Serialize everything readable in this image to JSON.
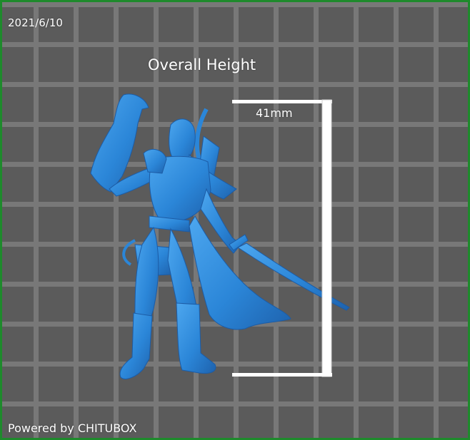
{
  "viewport": {
    "date": "2021/6/10",
    "title": "Overall Height",
    "measurement": "41mm",
    "footer": "Powered by CHITUBOX"
  },
  "model": {
    "name": "miniature-figure",
    "color": "#2b86d8"
  },
  "colors": {
    "frame_border": "#1e8a2c",
    "grid_background": "#5b5b5b",
    "grid_lines": "#787878",
    "ruler": "#ffffff"
  }
}
